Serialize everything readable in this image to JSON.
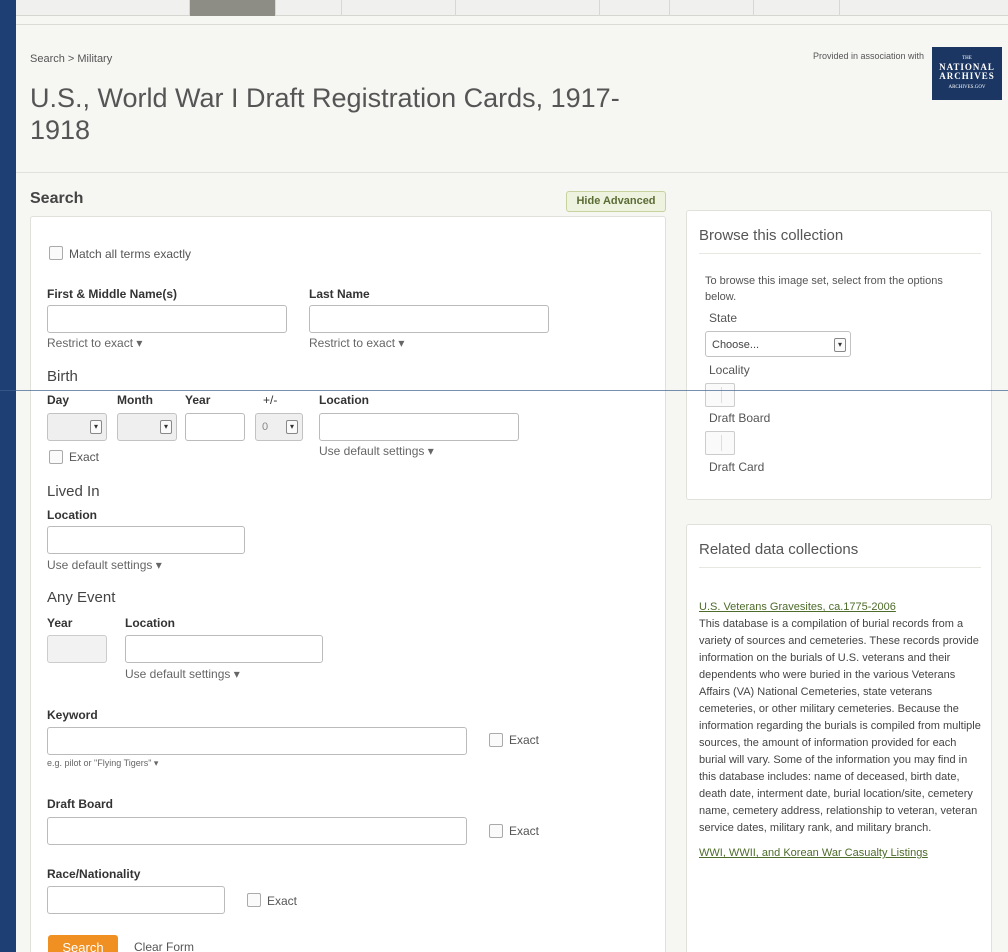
{
  "breadcrumb": "Search > Military",
  "title": "U.S., World War I Draft Registration Cards, 1917-1918",
  "association": {
    "text": "Provided in association with",
    "logo_lines": [
      "THE",
      "NATIONAL",
      "ARCHIVES",
      "ARCHIVES.GOV"
    ]
  },
  "search": {
    "heading": "Search",
    "hide_advanced": "Hide Advanced",
    "match_exact": "Match all terms exactly",
    "first_name_label": "First & Middle Name(s)",
    "last_name_label": "Last Name",
    "restrict_exact_1": "Restrict to exact ▾",
    "restrict_exact_2": "Restrict to exact ▾",
    "birth": {
      "heading": "Birth",
      "day_label": "Day",
      "month_label": "Month",
      "year_label": "Year",
      "plusminus_label": "+/-",
      "plusminus_value": "0",
      "location_label": "Location",
      "exact_label": "Exact",
      "default_settings": "Use default settings ▾"
    },
    "lived_in": {
      "heading": "Lived In",
      "location_label": "Location",
      "default_settings": "Use default settings ▾"
    },
    "any_event": {
      "heading": "Any Event",
      "year_label": "Year",
      "location_label": "Location",
      "default_settings": "Use default settings ▾"
    },
    "keyword": {
      "label": "Keyword",
      "exact_label": "Exact",
      "hint": "e.g. pilot or \"Flying Tigers\" ▾"
    },
    "draft_board": {
      "label": "Draft Board",
      "exact_label": "Exact"
    },
    "race": {
      "label": "Race/Nationality",
      "exact_label": "Exact"
    },
    "search_button": "Search",
    "clear_form": "Clear Form"
  },
  "browse": {
    "heading": "Browse this collection",
    "intro": "To browse this image set, select from the options below.",
    "state_label": "State",
    "state_value": "Choose...",
    "locality_label": "Locality",
    "draft_board_label": "Draft Board",
    "draft_card_label": "Draft Card"
  },
  "related": {
    "heading": "Related data collections",
    "link_1": "U.S. Veterans Gravesites, ca.1775-2006",
    "description": "This database is a compilation of burial records from a variety of sources and cemeteries. These records provide information on the burials of U.S. veterans and their dependents who were buried in the various Veterans Affairs (VA) National Cemeteries, state veterans cemeteries, or other military cemeteries. Because the information regarding the burials is compiled from multiple sources, the amount of information provided for each burial will vary. Some of the information you may find in this database includes: name of deceased, birth date, death date, interment date, burial location/site, cemetery name, cemetery address, relationship to veteran, veteran service dates, military rank, and military branch.",
    "link_2": "WWI, WWII, and Korean War Casualty Listings"
  }
}
